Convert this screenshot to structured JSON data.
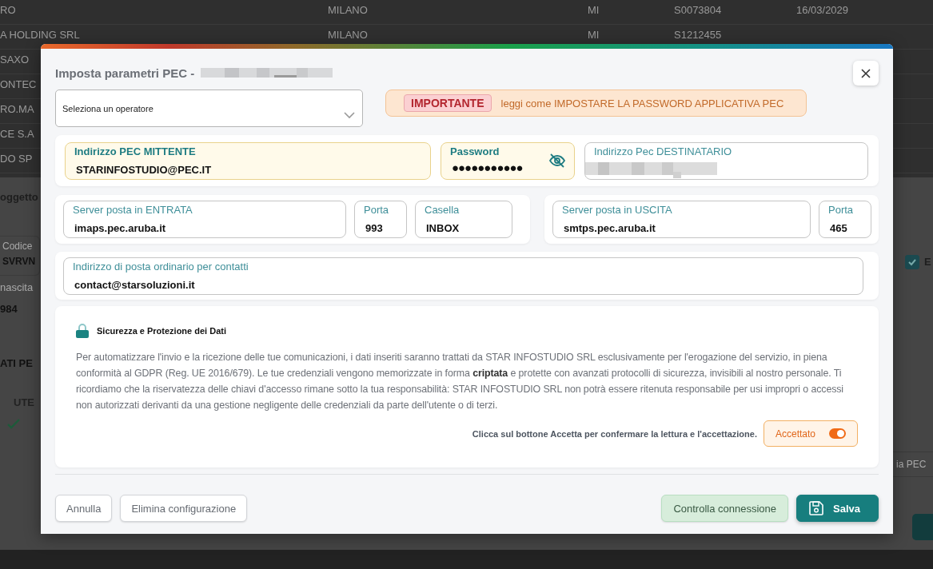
{
  "background": {
    "rows": [
      [
        "RO",
        "MILANO",
        "MI",
        "S0073804",
        "16/03/2029"
      ],
      [
        "A HOLDING SRL",
        "MILANO",
        "MI",
        "S1212455"
      ],
      [
        "SAXO"
      ],
      [
        "ONTEC"
      ],
      [
        "RO.MA"
      ],
      [
        "CE S.A"
      ],
      [
        "DO SP"
      ]
    ],
    "section_title": "oggetto",
    "fields": [
      {
        "label": "Codice",
        "value": "SVRVN"
      },
      {
        "label": "nascita",
        "value": "984"
      }
    ],
    "section_title_2": "ATI PE",
    "column_header": "UTE",
    "checkbox": {
      "label": "E",
      "checked": true
    },
    "button": "ia PEC"
  },
  "dialog": {
    "title": "Imposta parametri PEC - ",
    "operator_select": {
      "label": "Seleziona un operatore"
    },
    "notice": {
      "badge": "IMPORTANTE",
      "text": "leggi come IMPOSTARE LA PASSWORD APPLICATIVA PEC"
    },
    "sender_card": [
      {
        "label": "Indirizzo PEC MITTENTE",
        "value": "STARINFOSTUDIO@PEC.IT",
        "kind": "highlight"
      },
      {
        "label": "Password",
        "value": "●●●●●●●●●●●",
        "kind": "password"
      },
      {
        "label": "Indirizzo Pec DESTINATARIO",
        "kind": "redacted"
      }
    ],
    "incoming": [
      {
        "label": "Server posta in ENTRATA",
        "value": "imaps.pec.aruba.it"
      },
      {
        "label": "Porta",
        "value": "993"
      },
      {
        "label": "Casella",
        "value": "INBOX"
      }
    ],
    "outgoing": [
      {
        "label": "Server posta in USCITA",
        "value": "smtps.pec.aruba.it"
      },
      {
        "label": "Porta",
        "value": "465"
      }
    ],
    "contact": {
      "label": "Indirizzo di posta ordinario per contatti",
      "value": "contact@starsoluzioni.it"
    },
    "security": {
      "title": "Sicurezza e Protezione dei Dati",
      "text": "Per automatizzare l'invio e la ricezione delle tue comunicazioni, i dati inseriti saranno trattati da STAR INFOSTUDIO SRL esclusivamente per l'erogazione del servizio, in piena conformità al GDPR (Reg. UE 2016/679). Le tue credenziali vengono memorizzate in forma **criptata** e protette con avanzati protocolli di sicurezza, invisibili al nostro personale. Ti ricordiamo che la riservatezza delle chiavi d'accesso rimane sotto la tua responsabilità: STAR INFOSTUDIO SRL non potrà essere ritenuta responsabile per usi impropri o accessi non autorizzati derivanti da una gestione negligente delle credenziali da parte dell'utente o di terzi.",
      "consent_text": "Clicca sul bottone Accetta per confermare la lettura e l'accettazione.",
      "toggle": {
        "label": "Accettato",
        "on": true
      }
    },
    "footer_left": [
      "Annulla",
      "Elimina configurazione"
    ],
    "footer_right": [
      {
        "label": "Controlla connessione",
        "kind": "check"
      },
      {
        "label": "Salva",
        "kind": "primary"
      }
    ]
  }
}
